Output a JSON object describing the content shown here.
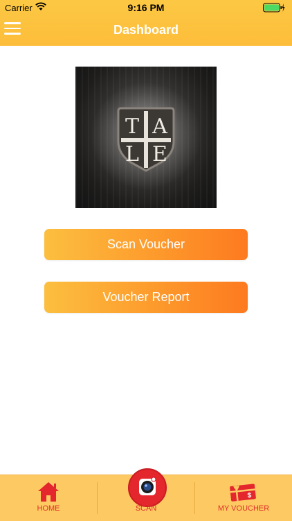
{
  "status": {
    "carrier": "Carrier",
    "time": "9:16 PM"
  },
  "header": {
    "title": "Dashboard",
    "menu_icon": "hamburger-menu-icon"
  },
  "logo": {
    "letters": [
      "T",
      "A",
      "L",
      "E"
    ]
  },
  "actions": {
    "scan_voucher": "Scan Voucher",
    "voucher_report": "Voucher Report"
  },
  "tabbar": {
    "home": "HOME",
    "scan": "SCAN",
    "my_voucher": "MY VOUCHER"
  },
  "colors": {
    "header": "#fdc24a",
    "button_start": "#fcbf3f",
    "button_end": "#fd7a1f",
    "tabbar": "#fdc962",
    "tab_label": "#e0302a"
  }
}
